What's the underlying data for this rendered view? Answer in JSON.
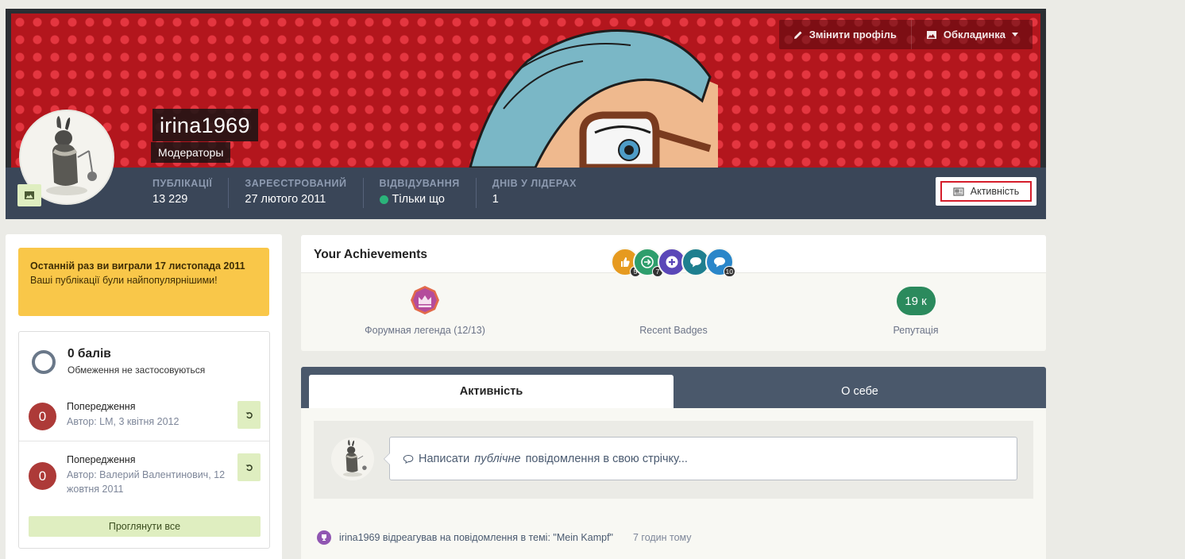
{
  "header": {
    "edit_profile_label": "Змінити профіль",
    "cover_label": "Обкладинка",
    "username": "irina1969",
    "group": "Модераторы",
    "stats": [
      {
        "label": "ПУБЛІКАЦІЇ",
        "value": "13 229"
      },
      {
        "label": "ЗАРЕЄСТРОВАНИЙ",
        "value": "27 лютого 2011"
      },
      {
        "label": "ВІДВІДУВАННЯ",
        "value": "Тільки що"
      },
      {
        "label": "ДНІВ У ЛІДЕРАХ",
        "value": "1"
      }
    ],
    "activity_button_label": "Активність",
    "online_color": "#2bb37a"
  },
  "sidebar": {
    "win_box": {
      "title": "Останній раз ви виграли 17 листопада 2011",
      "subtitle": "Ваші публікації були найпопулярнішими!"
    },
    "points": {
      "title": "0 балів",
      "subtitle": "Обмеження не застосовуються"
    },
    "warnings": [
      {
        "count": "0",
        "title": "Попередження",
        "author": "Автор: LM, 3 квітня 2012"
      },
      {
        "count": "0",
        "title": "Попередження",
        "author": "Автор: Валерий Валентинович, 12 жовтня 2011"
      }
    ],
    "view_all_label": "Проглянути все"
  },
  "achievements": {
    "title": "Your Achievements",
    "rank_label": "Форумная легенда (12/13)",
    "badges_label": "Recent Badges",
    "badges": [
      {
        "icon": "thumbs-up-icon",
        "color": "#e69a1f",
        "count": "5"
      },
      {
        "icon": "sign-in-icon",
        "color": "#2e9e6c",
        "count": "7"
      },
      {
        "icon": "plus-icon",
        "color": "#5a47b8",
        "count": ""
      },
      {
        "icon": "comment-icon",
        "color": "#1e7f8f",
        "count": ""
      },
      {
        "icon": "comments-icon",
        "color": "#2a86c9",
        "count": "10"
      }
    ],
    "reputation_value": "19 к",
    "reputation_label": "Репутація",
    "reputation_color": "#2b8a5d"
  },
  "feed": {
    "tabs": [
      {
        "label": "Активність",
        "active": true
      },
      {
        "label": "О себе",
        "active": false
      }
    ],
    "composer": {
      "prefix": "Написати",
      "emphasis": "публічне",
      "suffix": "повідомлення в свою стрічку..."
    },
    "item": {
      "text": "irina1969 відреагував на повідомлення в темі: \"Mein Kampf\"",
      "time": "7 годин тому"
    }
  }
}
